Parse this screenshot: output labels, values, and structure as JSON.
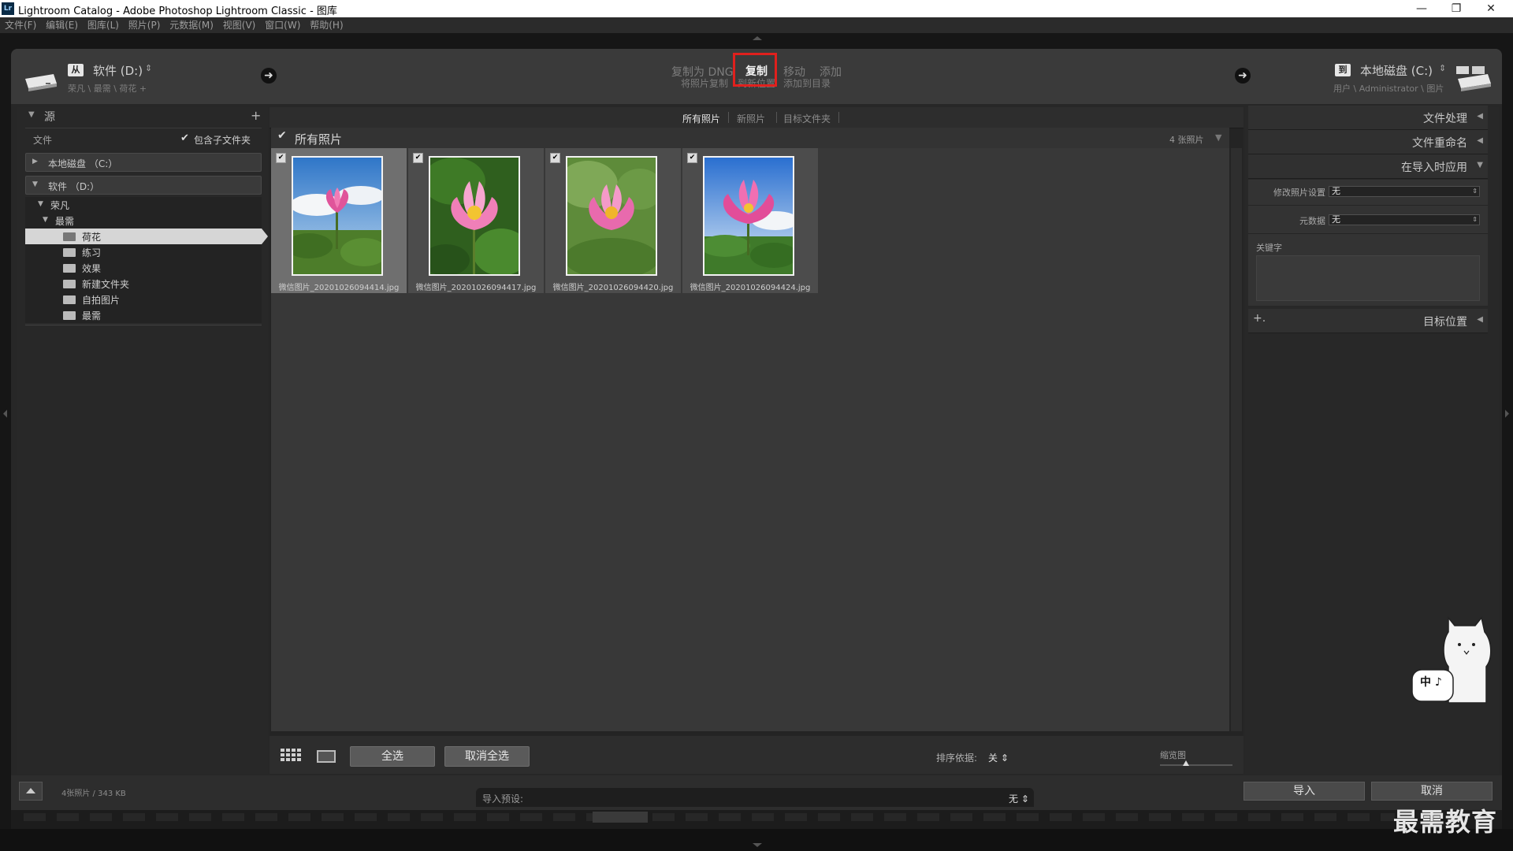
{
  "window": {
    "app_badge": "Lr",
    "title": "Lightroom Catalog - Adobe Photoshop Lightroom Classic - 图库",
    "controls": [
      "—",
      "❐",
      "✕"
    ]
  },
  "menu": [
    "文件(F)",
    "编辑(E)",
    "图库(L)",
    "照片(P)",
    "元数据(M)",
    "视图(V)",
    "窗口(W)",
    "帮助(H)"
  ],
  "source": {
    "badge": "从",
    "drive": "软件 (D:)",
    "chev": "⇕",
    "path": "荣凡 \\ 最需 \\ 荷花 +"
  },
  "modes": [
    {
      "label": "复制为 DNG",
      "active": false
    },
    {
      "label": "复制",
      "active": true
    },
    {
      "label": "移动",
      "active": false
    },
    {
      "label": "添加",
      "active": false
    }
  ],
  "mode_desc": {
    "left": "将照片复制",
    "middle": "到新位置",
    "right": "添加到目录"
  },
  "dest": {
    "badge": "到",
    "drive": "本地磁盘 (C:)",
    "chev": "⇕",
    "path": "用户 \\ Administrator \\ 图片"
  },
  "left_panel": {
    "title": "源",
    "plus": "+",
    "files_label": "文件",
    "include_subfolders": "包含子文件夹",
    "local_disk": "本地磁盘 （C:）",
    "software_disk": "软件 （D:）",
    "tree_root": "荣凡",
    "tree_sub": "最需",
    "folders": [
      "荷花",
      "练习",
      "效果",
      "新建文件夹",
      "自拍图片",
      "最需"
    ],
    "selected_folder_index": 0
  },
  "tabs": [
    "所有照片",
    "新照片",
    "目标文件夹"
  ],
  "active_tab": 0,
  "grid": {
    "header_label": "所有照片",
    "count": "4 张照片",
    "photos": [
      {
        "name": "微信图片_20201026094414.jpg",
        "selected": true
      },
      {
        "name": "微信图片_20201026094417.jpg",
        "selected": false
      },
      {
        "name": "微信图片_20201026094420.jpg",
        "selected": false
      },
      {
        "name": "微信图片_20201026094424.jpg",
        "selected": false
      }
    ]
  },
  "toolbar": {
    "select_all": "全选",
    "deselect_all": "取消全选",
    "sort_label": "排序依据:",
    "sort_value": "关 ⇕",
    "thumb_label": "缩览图"
  },
  "right_panel": {
    "file_handling": "文件处理",
    "file_rename": "文件重命名",
    "apply_during_import": "在导入时应用",
    "develop_settings_label": "修改照片设置",
    "develop_settings_value": "无",
    "metadata_label": "元数据",
    "metadata_value": "无",
    "keywords_label": "关键字",
    "destination": "目标位置",
    "plus": "+."
  },
  "bottom": {
    "status": "4张照片 / 343 KB",
    "preset_label": "导入预设:",
    "preset_value": "无 ⇕",
    "import_btn": "导入",
    "cancel_btn": "取消"
  },
  "mascot_text": "中 ♪",
  "watermark": "最需教育",
  "colors": {
    "highlight": "#e0201d",
    "panel": "#282828",
    "grid": "#383838"
  }
}
